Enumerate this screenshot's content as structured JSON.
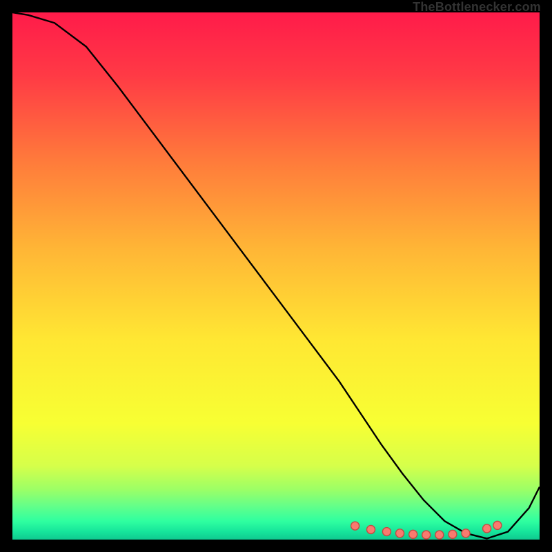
{
  "attribution": "TheBottlenecker.com",
  "chart_data": {
    "type": "line",
    "title": "",
    "xlabel": "",
    "ylabel": "",
    "xlim": [
      0,
      100
    ],
    "ylim": [
      0,
      100
    ],
    "grid": false,
    "series": [
      {
        "name": "curve",
        "x": [
          0,
          3,
          8,
          14,
          20,
          26,
          32,
          38,
          44,
          50,
          56,
          62,
          66,
          70,
          74,
          78,
          82,
          86,
          90,
          94,
          98,
          100
        ],
        "y": [
          100,
          99.5,
          98,
          93.5,
          86,
          78,
          70,
          62,
          54,
          46,
          38,
          30,
          24,
          18,
          12.5,
          7.5,
          3.5,
          1.2,
          0.2,
          1.5,
          6,
          10
        ]
      }
    ],
    "markers": {
      "name": "points",
      "x": [
        65,
        68,
        71,
        73.5,
        76,
        78.5,
        81,
        83.5,
        86,
        90,
        92
      ],
      "y": [
        2.6,
        1.9,
        1.5,
        1.2,
        1.0,
        0.9,
        0.9,
        1.0,
        1.2,
        2.1,
        2.7
      ]
    },
    "gradient_stops": [
      {
        "offset": 0.0,
        "color": "#ff1b4a"
      },
      {
        "offset": 0.12,
        "color": "#ff3a45"
      },
      {
        "offset": 0.28,
        "color": "#ff7a3b"
      },
      {
        "offset": 0.45,
        "color": "#ffb636"
      },
      {
        "offset": 0.62,
        "color": "#ffe733"
      },
      {
        "offset": 0.78,
        "color": "#f7ff33"
      },
      {
        "offset": 0.86,
        "color": "#d6ff4a"
      },
      {
        "offset": 0.905,
        "color": "#9cff66"
      },
      {
        "offset": 0.935,
        "color": "#66ff88"
      },
      {
        "offset": 0.965,
        "color": "#2fffa0"
      },
      {
        "offset": 0.985,
        "color": "#16e59b"
      },
      {
        "offset": 1.0,
        "color": "#0fc990"
      }
    ],
    "marker_style": {
      "fill": "#f97a6f",
      "stroke": "#c44a42",
      "r": 6
    }
  }
}
